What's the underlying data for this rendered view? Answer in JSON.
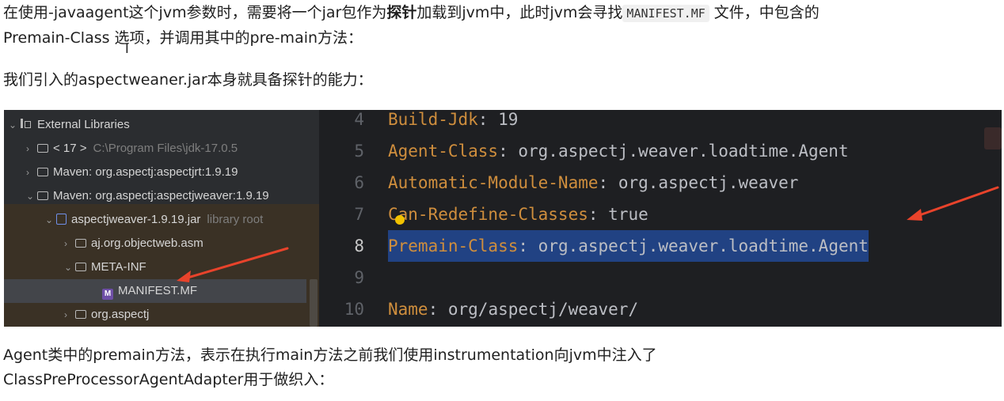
{
  "paragraph1": {
    "before": "在使用-javaagent这个jvm参数时，需要将一个jar包作为",
    "bold": "探针",
    "middle": "加载到jvm中，此时jvm会寻找",
    "code": "MANIFEST.MF",
    "after": " 文件，中包含的",
    "line2": "Premain-Class 选项，并调用其中的pre-main方法："
  },
  "paragraph2": "我们引入的aspectweaner.jar本身就具备探针的能力：",
  "paragraph3": {
    "line1": "Agent类中的premain方法，表示在执行main方法之前我们使用instrumentation向jvm中注入了",
    "line2": "ClassPreProcessorAgentAdapter用于做织入："
  },
  "project_tree": {
    "items": [
      {
        "label": "External Libraries",
        "hint": ""
      },
      {
        "label": "< 17 >",
        "hint": "C:\\Program Files\\jdk-17.0.5"
      },
      {
        "label": "Maven: org.aspectj:aspectjrt:1.9.19",
        "hint": ""
      },
      {
        "label": "Maven: org.aspectj:aspectjweaver:1.9.19",
        "hint": ""
      },
      {
        "label": "aspectjweaver-1.9.19.jar",
        "hint": "library root"
      },
      {
        "label": "aj.org.objectweb.asm",
        "hint": ""
      },
      {
        "label": "META-INF",
        "hint": ""
      },
      {
        "label": "MANIFEST.MF",
        "hint": ""
      },
      {
        "label": "org.aspectj",
        "hint": ""
      }
    ]
  },
  "editor": {
    "lines": [
      {
        "num": "4",
        "key": "Build-Jdk",
        "sep": ": ",
        "value": "19"
      },
      {
        "num": "5",
        "key": "Agent-Class",
        "sep": ": ",
        "value": "org.aspectj.weaver.loadtime.Agent"
      },
      {
        "num": "6",
        "key": "Automatic-Module-Name",
        "sep": ": ",
        "value": "org.aspectj.weaver"
      },
      {
        "num": "7",
        "key": "Can-Redefine-Classes",
        "sep": ": ",
        "value": "true"
      },
      {
        "num": "8",
        "key": "Premain-Class",
        "sep": ": ",
        "value": "org.aspectj.weaver.loadtime.Agent"
      },
      {
        "num": "9",
        "key": "",
        "sep": "",
        "value": ""
      },
      {
        "num": "10",
        "key": "Name",
        "sep": ": ",
        "value": "org/aspectj/weaver/"
      }
    ]
  },
  "colors": {
    "key": "#cf8e3d",
    "value": "#bcbec4",
    "selection": "#214283",
    "arrow": "#e8432b"
  }
}
